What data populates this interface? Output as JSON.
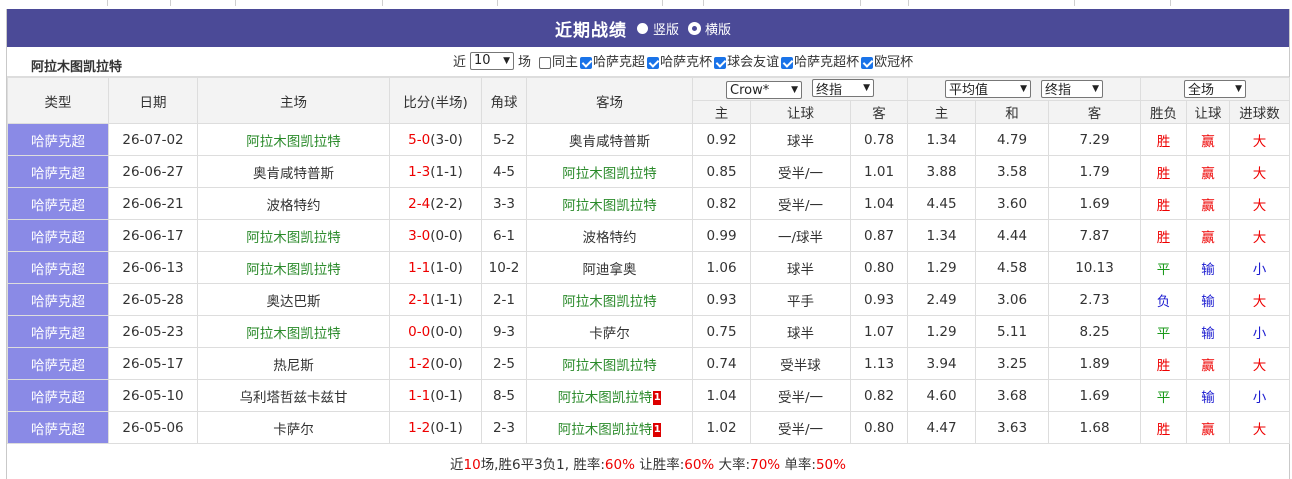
{
  "title": "近期战绩",
  "view_modes": [
    {
      "label": "竖版",
      "selected": false
    },
    {
      "label": "横版",
      "selected": true
    }
  ],
  "team_name": "阿拉木图凯拉特",
  "filter": {
    "prefix": "近",
    "count": "10",
    "suffix": "场",
    "checkboxes": [
      {
        "label": "同主",
        "checked": false
      },
      {
        "label": "哈萨克超",
        "checked": true
      },
      {
        "label": "哈萨克杯",
        "checked": true
      },
      {
        "label": "球会友谊",
        "checked": true
      },
      {
        "label": "哈萨克超杯",
        "checked": true
      },
      {
        "label": "欧冠杯",
        "checked": true
      }
    ]
  },
  "headers": {
    "type": "类型",
    "date": "日期",
    "home": "主场",
    "score": "比分(半场)",
    "corner": "角球",
    "away": "客场",
    "company_select": "Crow*",
    "handicap_select": "终指",
    "avg_select": "平均值",
    "odds_select": "终指",
    "scope_select": "全场",
    "sub": {
      "h_home": "主",
      "h_line": "让球",
      "h_away": "客",
      "o_home": "主",
      "o_draw": "和",
      "o_away": "客",
      "res": "胜负",
      "ah": "让球",
      "ou": "进球数"
    }
  },
  "rows": [
    {
      "type": "哈萨克超",
      "date": "26-07-02",
      "home": "阿拉木图凯拉特",
      "home_hl": true,
      "score": "5-0",
      "half": "(3-0)",
      "corner": "5-2",
      "away": "奥肯咸特普斯",
      "away_hl": false,
      "away_card": "",
      "h_home": "0.92",
      "h_line": "球半",
      "h_away": "0.78",
      "o_home": "1.34",
      "o_draw": "4.79",
      "o_away": "7.29",
      "res": "胜",
      "ah": "赢",
      "ou": "大"
    },
    {
      "type": "哈萨克超",
      "date": "26-06-27",
      "home": "奥肯咸特普斯",
      "home_hl": false,
      "score": "1-3",
      "half": "(1-1)",
      "corner": "4-5",
      "away": "阿拉木图凯拉特",
      "away_hl": true,
      "away_card": "",
      "h_home": "0.85",
      "h_line": "受半/一",
      "h_away": "1.01",
      "o_home": "3.88",
      "o_draw": "3.58",
      "o_away": "1.79",
      "res": "胜",
      "ah": "赢",
      "ou": "大"
    },
    {
      "type": "哈萨克超",
      "date": "26-06-21",
      "home": "波格特约",
      "home_hl": false,
      "score": "2-4",
      "half": "(2-2)",
      "corner": "3-3",
      "away": "阿拉木图凯拉特",
      "away_hl": true,
      "away_card": "",
      "h_home": "0.82",
      "h_line": "受半/一",
      "h_away": "1.04",
      "o_home": "4.45",
      "o_draw": "3.60",
      "o_away": "1.69",
      "res": "胜",
      "ah": "赢",
      "ou": "大"
    },
    {
      "type": "哈萨克超",
      "date": "26-06-17",
      "home": "阿拉木图凯拉特",
      "home_hl": true,
      "score": "3-0",
      "half": "(0-0)",
      "corner": "6-1",
      "away": "波格特约",
      "away_hl": false,
      "away_card": "",
      "h_home": "0.99",
      "h_line": "一/球半",
      "h_away": "0.87",
      "o_home": "1.34",
      "o_draw": "4.44",
      "o_away": "7.87",
      "res": "胜",
      "ah": "赢",
      "ou": "大"
    },
    {
      "type": "哈萨克超",
      "date": "26-06-13",
      "home": "阿拉木图凯拉特",
      "home_hl": true,
      "score": "1-1",
      "half": "(1-0)",
      "corner": "10-2",
      "away": "阿迪拿奥",
      "away_hl": false,
      "away_card": "",
      "h_home": "1.06",
      "h_line": "球半",
      "h_away": "0.80",
      "o_home": "1.29",
      "o_draw": "4.58",
      "o_away": "10.13",
      "res": "平",
      "ah": "输",
      "ou": "小"
    },
    {
      "type": "哈萨克超",
      "date": "26-05-28",
      "home": "奥达巴斯",
      "home_hl": false,
      "score": "2-1",
      "half": "(1-1)",
      "corner": "2-1",
      "away": "阿拉木图凯拉特",
      "away_hl": true,
      "away_card": "",
      "h_home": "0.93",
      "h_line": "平手",
      "h_away": "0.93",
      "o_home": "2.49",
      "o_draw": "3.06",
      "o_away": "2.73",
      "res": "负",
      "ah": "输",
      "ou": "大"
    },
    {
      "type": "哈萨克超",
      "date": "26-05-23",
      "home": "阿拉木图凯拉特",
      "home_hl": true,
      "score": "0-0",
      "half": "(0-0)",
      "corner": "9-3",
      "away": "卡萨尔",
      "away_hl": false,
      "away_card": "",
      "h_home": "0.75",
      "h_line": "球半",
      "h_away": "1.07",
      "o_home": "1.29",
      "o_draw": "5.11",
      "o_away": "8.25",
      "res": "平",
      "ah": "输",
      "ou": "小"
    },
    {
      "type": "哈萨克超",
      "date": "26-05-17",
      "home": "热尼斯",
      "home_hl": false,
      "score": "1-2",
      "half": "(0-0)",
      "corner": "2-5",
      "away": "阿拉木图凯拉特",
      "away_hl": true,
      "away_card": "",
      "h_home": "0.74",
      "h_line": "受半球",
      "h_away": "1.13",
      "o_home": "3.94",
      "o_draw": "3.25",
      "o_away": "1.89",
      "res": "胜",
      "ah": "赢",
      "ou": "大"
    },
    {
      "type": "哈萨克超",
      "date": "26-05-10",
      "home": "乌利塔哲兹卡兹甘",
      "home_hl": false,
      "score": "1-1",
      "half": "(0-1)",
      "corner": "8-5",
      "away": "阿拉木图凯拉特",
      "away_hl": true,
      "away_card": "1",
      "h_home": "1.04",
      "h_line": "受半/一",
      "h_away": "0.82",
      "o_home": "4.60",
      "o_draw": "3.68",
      "o_away": "1.69",
      "res": "平",
      "ah": "输",
      "ou": "小"
    },
    {
      "type": "哈萨克超",
      "date": "26-05-06",
      "home": "卡萨尔",
      "home_hl": false,
      "score": "1-2",
      "half": "(0-1)",
      "corner": "2-3",
      "away": "阿拉木图凯拉特",
      "away_hl": true,
      "away_card": "1",
      "h_home": "1.02",
      "h_line": "受半/一",
      "h_away": "0.80",
      "o_home": "4.47",
      "o_draw": "3.63",
      "o_away": "1.68",
      "res": "胜",
      "ah": "赢",
      "ou": "大"
    }
  ],
  "summary": {
    "p1": "近",
    "n_games": "10",
    "p2": "场,胜6平3负1, 胜率:",
    "win_rate": "60%",
    "p3": " 让胜率:",
    "ah_rate": "60%",
    "p4": " 大率:",
    "over_rate": "70%",
    "p5": " 单率:",
    "odd_rate": "50%"
  },
  "colors": {
    "header_bar": "#4b4a97",
    "type_cell": "#8a8ae6",
    "win": "#e00000",
    "draw": "#1a9a1a",
    "loss": "#1b1bd0",
    "team_green": "#2a8a2a"
  }
}
